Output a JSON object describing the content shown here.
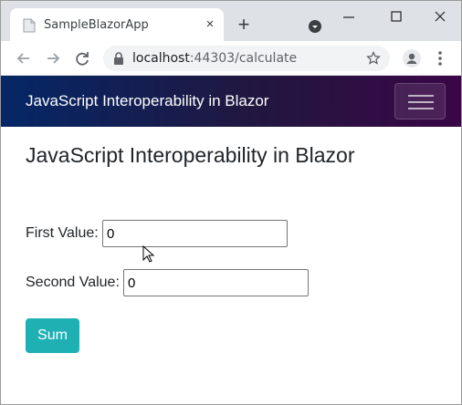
{
  "browser": {
    "tab": {
      "title": "SampleBlazorApp",
      "close_glyph": "×",
      "favicon": "page-icon"
    },
    "new_tab_glyph": "+",
    "address": {
      "host": "localhost",
      "rest": ":44303/calculate"
    }
  },
  "app": {
    "brand": "JavaScript Interoperability in Blazor",
    "page_title": "JavaScript Interoperability in Blazor",
    "form": {
      "first_label": "First Value:",
      "first_value": "0",
      "second_label": "Second Value:",
      "second_value": "0",
      "sum_label": "Sum"
    }
  },
  "colors": {
    "accent_button": "#1fb0b4",
    "navbar_start": "#052767",
    "navbar_end": "#3a0647"
  }
}
